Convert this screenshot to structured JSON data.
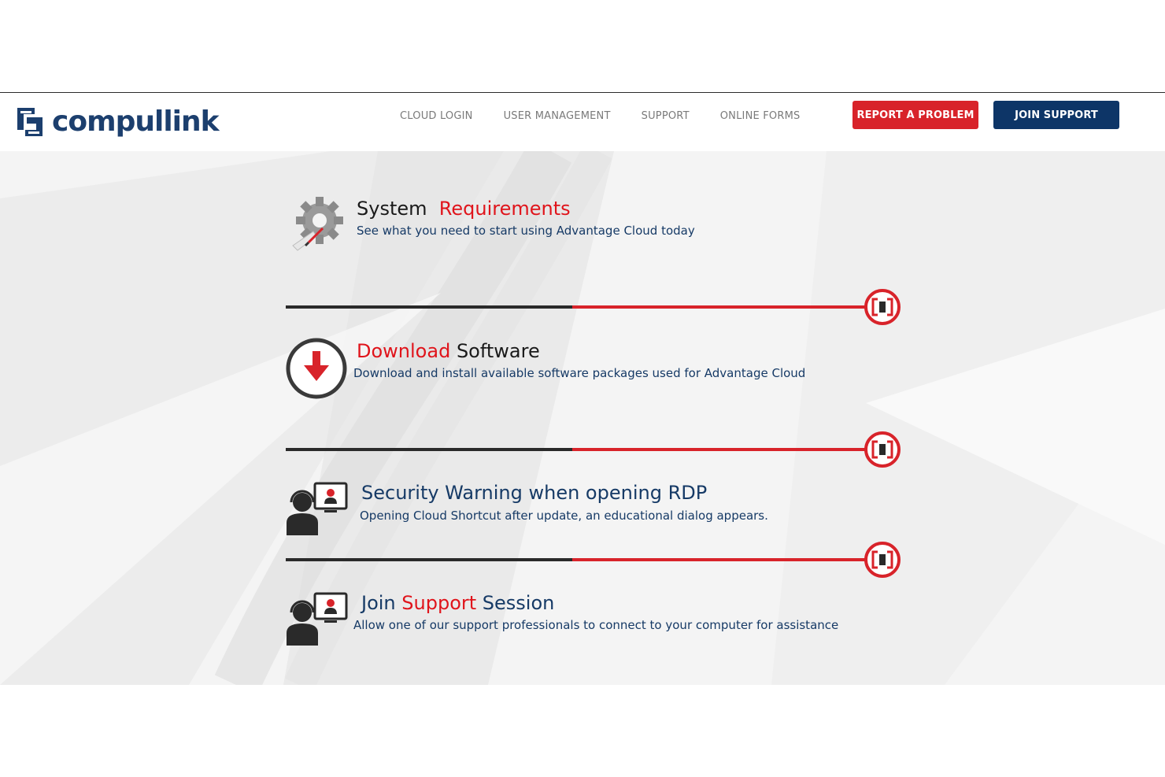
{
  "brand": {
    "name": "compulink",
    "name_part1": "compul",
    "name_part2": "ink",
    "colors": {
      "primary": "#1c3f6e",
      "accent": "#d8232a",
      "navy": "#0d3567"
    }
  },
  "nav": {
    "items": [
      {
        "label": "CLOUD LOGIN"
      },
      {
        "label": "USER MANAGEMENT"
      },
      {
        "label": "SUPPORT"
      },
      {
        "label": "ONLINE FORMS"
      }
    ],
    "report_label": "REPORT A PROBLEM",
    "join_label": "JOIN SUPPORT"
  },
  "sections": [
    {
      "title_part1": "System",
      "title_part2": "Requirements",
      "description": "See what you need to start using Advantage Cloud today",
      "icon": "gear-wrench-icon"
    },
    {
      "title_part1": "Download",
      "title_part2": "Software",
      "description": "Download and install available software packages used for Advantage Cloud",
      "icon": "download-icon"
    },
    {
      "title": "Security Warning when opening RDP",
      "description": "Opening Cloud Shortcut after update, an educational dialog appears.",
      "icon": "support-agent-icon"
    },
    {
      "title_part1": "Join",
      "title_part2": "Support",
      "title_part3": "Session",
      "description": "Allow one of our support professionals to connect to your computer for assistance",
      "icon": "support-agent-icon"
    }
  ]
}
